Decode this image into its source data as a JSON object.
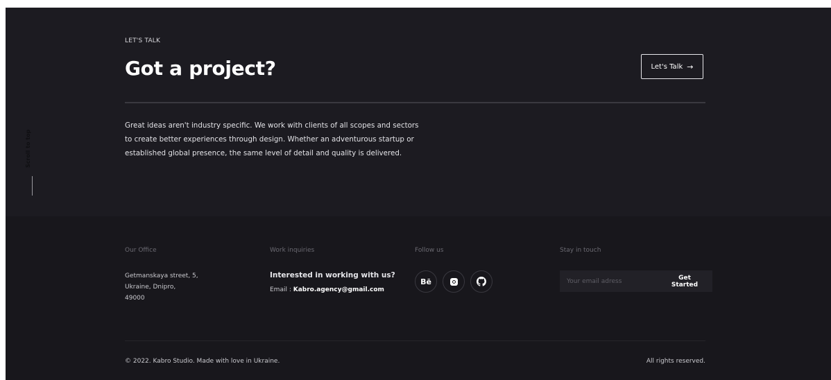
{
  "scroll_top": {
    "label": "Scroll to top"
  },
  "cta": {
    "eyebrow": "LET'S TALK",
    "title": "Got a project?",
    "button_label": "Let's Talk",
    "button_arrow": "→",
    "description": "Great ideas aren't industry specific. We work with clients of all scopes and sectors to create better experiences through design. Whether an adventurous startup or established global presence, the same level of detail and quality is delivered."
  },
  "footer": {
    "office": {
      "heading": "Our Office",
      "address_lines": [
        "Getmanskaya street, 5,",
        "Ukraine, Dnipro,",
        "49000"
      ]
    },
    "work": {
      "heading": "Work inquiries",
      "question": "Interested in working with us?",
      "email_label": "Email :",
      "email": "Kabro.agency@gmail.com"
    },
    "follow": {
      "heading": "Follow us",
      "socials": [
        {
          "name": "behance",
          "glyph": "Bē"
        },
        {
          "name": "instagram",
          "glyph": ""
        },
        {
          "name": "github",
          "glyph": ""
        }
      ]
    },
    "newsletter": {
      "heading": "Stay in touch",
      "placeholder": "Your email adress",
      "button_label": "Get Started"
    },
    "copyright": "© 2022. Kabro Studio. Made with love in Ukraine.",
    "rights": "All rights reserved."
  },
  "colors": {
    "background": "#1c1b21",
    "footer_background": "#18171c",
    "text": "#ffffff",
    "muted": "#6b6a72"
  }
}
